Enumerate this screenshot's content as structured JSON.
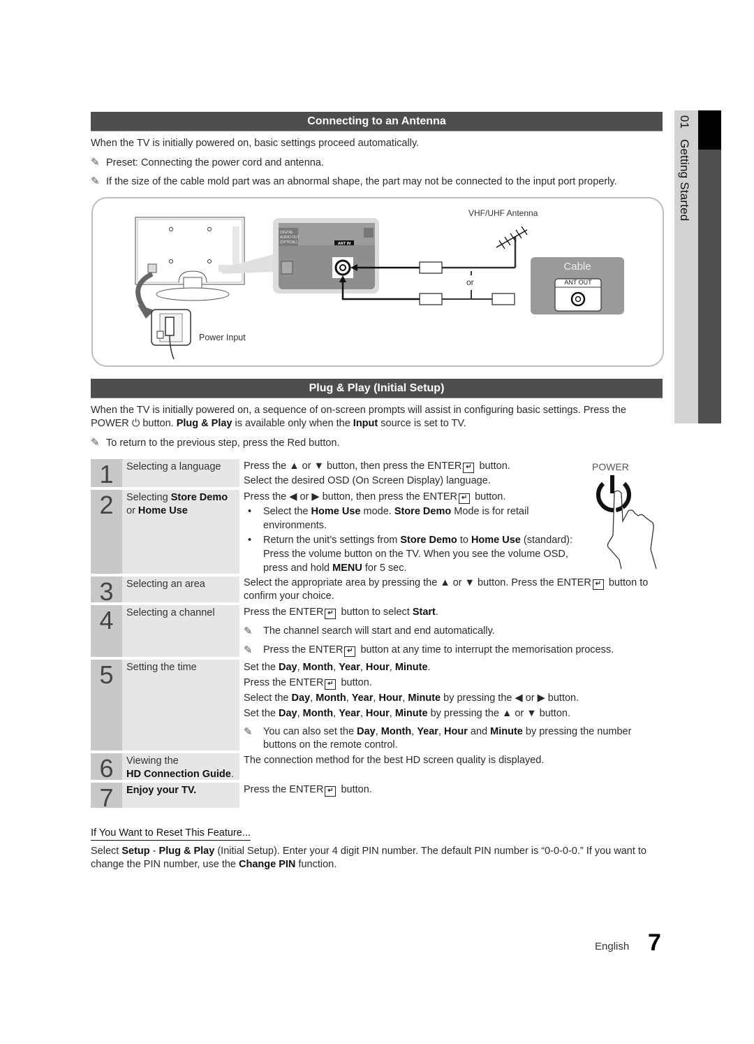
{
  "side_tab": {
    "chapter": "01",
    "title": "Getting Started"
  },
  "antenna_section": {
    "header": "Connecting to an Antenna",
    "intro": "When the TV is initially powered on, basic settings proceed automatically.",
    "notes": [
      "Preset: Connecting the power cord and antenna.",
      "If the size of the cable mold part was an abnormal shape, the part may not be connected to the input port properly."
    ],
    "diagram": {
      "antenna_label": "VHF/UHF Antenna",
      "or_label": "or",
      "cable_label": "Cable",
      "ant_out_label": "ANT OUT",
      "ant_in_label": "ANT IN",
      "digital_audio_label": [
        "DIGITAL",
        "AUDIO OUT",
        "(OPTICAL)"
      ],
      "power_input_label": "Power Input"
    }
  },
  "plug_play_section": {
    "header": "Plug & Play (Initial Setup)",
    "intro_1": "When the TV is initially powered on, a sequence of on-screen prompts will assist in configuring basic settings. Press the",
    "intro_power": "POWER",
    "intro_2": "button.",
    "intro_plug": "Plug & Play",
    "intro_3": "is available only when the",
    "intro_input": "Input",
    "intro_4": "source is set to TV.",
    "note": "To return to the previous step, press the Red button.",
    "power_graphic_label": "POWER",
    "steps": [
      {
        "num": "1",
        "title": "Selecting a language"
      },
      {
        "num": "2",
        "title_pre": "Selecting ",
        "title_b1": "Store Demo",
        "title_mid": "or ",
        "title_b2": "Home Use"
      },
      {
        "num": "3",
        "title": "Selecting an area"
      },
      {
        "num": "4",
        "title": "Selecting a channel"
      },
      {
        "num": "5",
        "title": "Setting the time"
      },
      {
        "num": "6",
        "title_pre": "Viewing the",
        "title_b1": "HD Connection Guide",
        "title_post": "."
      },
      {
        "num": "7",
        "title_b1": "Enjoy your TV."
      }
    ]
  },
  "common": {
    "press_the": "Press the",
    "button": "button",
    "enter": "ENTER",
    "then_press": "button, then press the",
    "up_down": "▲ or ▼",
    "left_right": "◀ or ▶"
  },
  "step_text": {
    "s1_l2": "Select the desired OSD (On Screen Display) language.",
    "s2_b1_a": "Select the",
    "s2_b1_home": "Home Use",
    "s2_b1_b": "mode.",
    "s2_b1_store": "Store Demo",
    "s2_b1_c": "Mode is for retail environments.",
    "s2_b2_a": "Return the unit’s settings from",
    "s2_b2_store": "Store Demo",
    "s2_b2_to": "to",
    "s2_b2_home": "Home Use",
    "s2_b2_b": "(standard): Press the volume button on the TV. When you see the volume OSD, press and hold",
    "s2_b2_menu": "MENU",
    "s2_b2_c": "for 5 sec.",
    "s3_a": "Select the appropriate area by pressing the",
    "s3_b": "button. Press the",
    "s3_c": "button to confirm your choice.",
    "s4_a": "button to select",
    "s4_start": "Start",
    "s4_note1": "The channel search will start and end automatically.",
    "s4_note2_b": "button at any time to interrupt the memorisation process.",
    "s5_set": "Set the",
    "s5_select": "Select the",
    "s5_day": "Day",
    "s5_month": "Month",
    "s5_year": "Year",
    "s5_hour": "Hour",
    "s5_minute": "Minute",
    "s5_by_pressing": "by pressing the",
    "s5_note_a": "You can also set the",
    "s5_and": "and",
    "s5_note_b": "by pressing the number buttons on the remote control.",
    "s6": "The connection method for the best HD screen quality is displayed."
  },
  "reset": {
    "title": "If You Want to Reset This Feature...",
    "t1": "Select",
    "setup": "Setup",
    "dash": "-",
    "plug": "Plug & Play",
    "t2": "(Initial Setup). Enter your 4 digit PIN number. The default PIN number is “0-0-0-0.” If you want to change the PIN number, use the",
    "change_pin": "Change PIN",
    "t3": "function."
  },
  "footer": {
    "language": "English",
    "page": "7"
  }
}
